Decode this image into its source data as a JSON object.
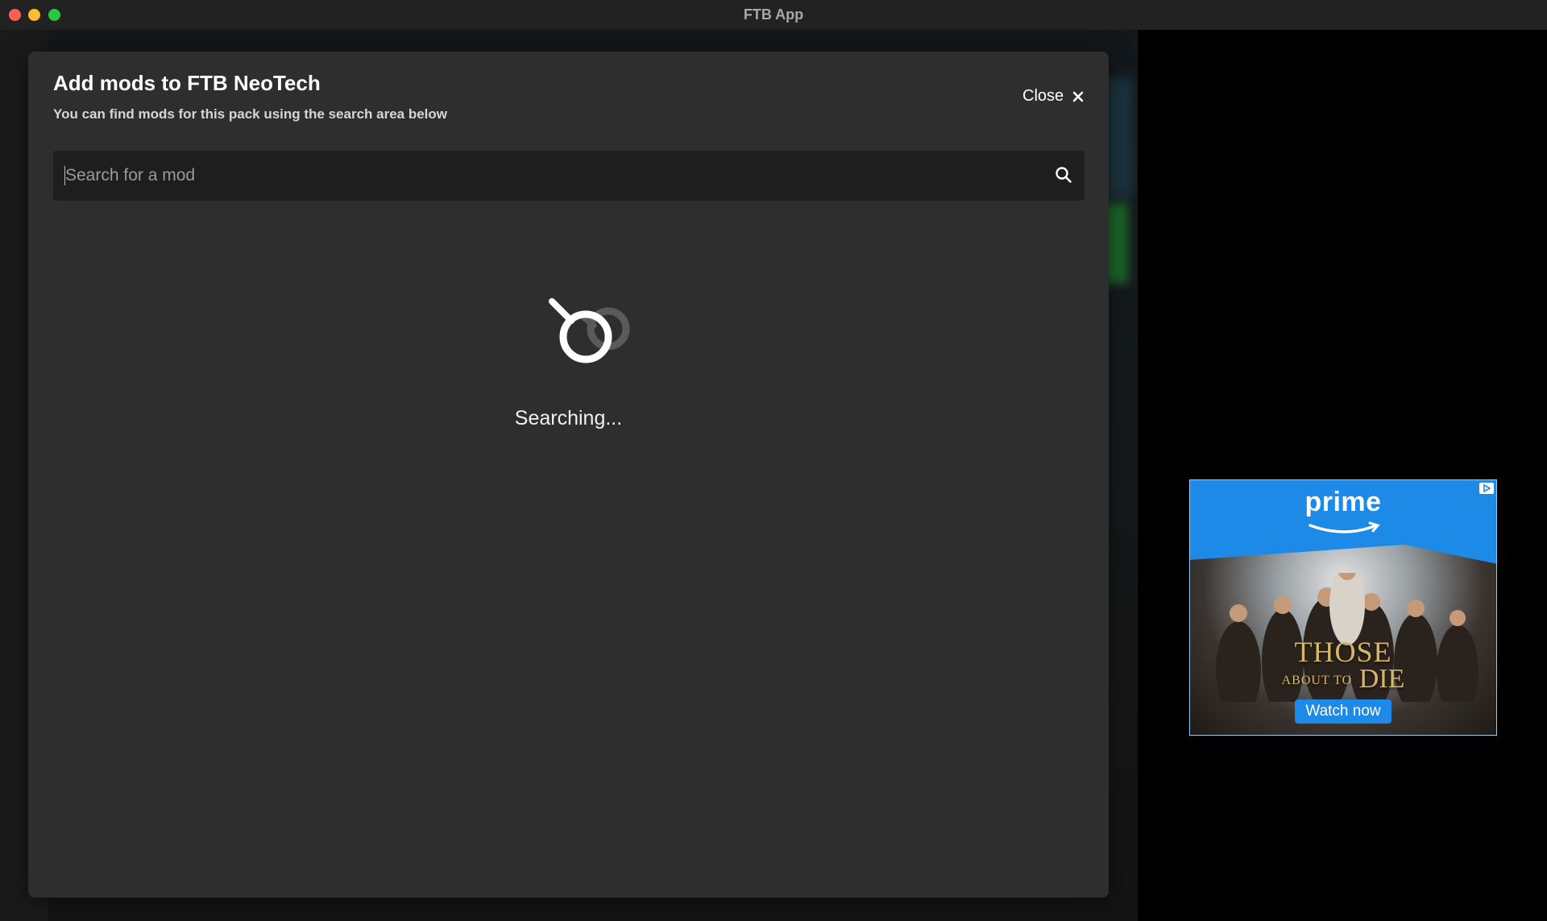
{
  "window": {
    "title": "FTB App"
  },
  "modal": {
    "title": "Add mods to FTB NeoTech",
    "subtitle": "You can find mods for this pack using the search area below",
    "close_label": "Close",
    "search": {
      "placeholder": "Search for a mod",
      "value": ""
    },
    "status_text": "Searching..."
  },
  "ad": {
    "brand": "prime",
    "headline": "THOSE",
    "subhead_small": "ABOUT TO",
    "subhead": "DIE",
    "cta": "Watch now"
  },
  "colors": {
    "modal_bg": "#2e2e2e",
    "search_bg": "#1e1e1e",
    "ad_blue": "#1e8ae8",
    "ad_gold": "#d9b56a"
  }
}
